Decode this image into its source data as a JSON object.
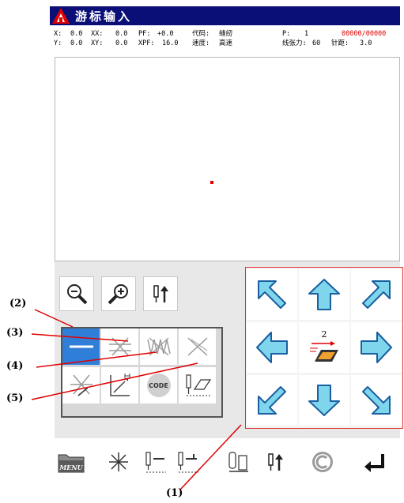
{
  "window": {
    "title": "游标输入"
  },
  "status": {
    "x_label": "X:",
    "x_value": "0.0",
    "xx_label": "XX:",
    "xx_value": "0.0",
    "pf_label": "PF:",
    "pf_value": "+0.0",
    "code_label": "代码:",
    "code_value": "缝纫",
    "p_label": "P:",
    "p_value": "1",
    "counter": "00000/00000",
    "y_label": "Y:",
    "y_value": "0.0",
    "xy_label": "XY:",
    "xy_value": "0.0",
    "xpf_label": "XPF:",
    "xpf_value": "16.0",
    "speed_label": "速度:",
    "speed_value": "高速",
    "tension_label": "线张力:",
    "tension_value": "60",
    "stitch_label": "针距:",
    "stitch_value": "3.0"
  },
  "center_control": {
    "value": "2"
  },
  "sub_panel": {
    "code_label": "CODE"
  },
  "bottom": {
    "menu_label": "MENU"
  },
  "annotations": {
    "a1": "(1)",
    "a2": "(2)",
    "a3": "(3)",
    "a4": "(4)",
    "a5": "(5)"
  },
  "colors": {
    "titlebar": "#0a0f78",
    "arrow_fill": "#7fd6ec",
    "arrow_stroke": "#1a5fa0",
    "selected": "#2f7fd9",
    "annotation_red": "#e00000"
  }
}
